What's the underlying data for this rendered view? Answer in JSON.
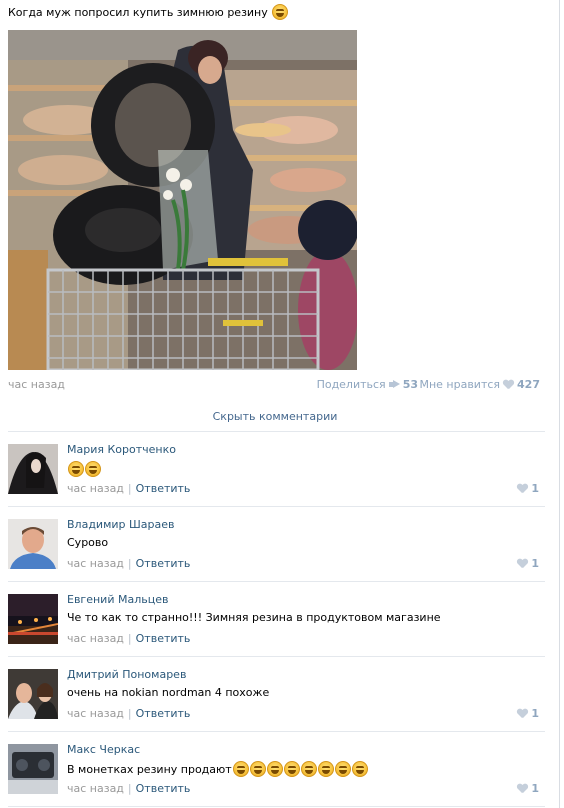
{
  "post": {
    "text": "Когда муж попросил купить зимнюю резину",
    "time": "час назад",
    "share_label": "Поделиться",
    "share_count": "53",
    "like_label": "Мне нравится",
    "like_count": "427",
    "hide_comments_label": "Скрыть комментарии"
  },
  "comments": [
    {
      "author": "Мария Коротченко",
      "text": "",
      "emoji_count": 2,
      "time": "час назад",
      "reply": "Ответить",
      "likes": "1"
    },
    {
      "author": "Владимир Шараев",
      "text": "Сурово",
      "emoji_count": 0,
      "time": "час назад",
      "reply": "Ответить",
      "likes": "1"
    },
    {
      "author": "Евгений Мальцев",
      "text": "Че то как то странно!!! Зимняя резина в продуктовом магазине",
      "emoji_count": 0,
      "time": "час назад",
      "reply": "Ответить",
      "likes": ""
    },
    {
      "author": "Дмитрий Пономарев",
      "text": "очень на nokian nordman 4 похоже",
      "emoji_count": 0,
      "time": "час назад",
      "reply": "Ответить",
      "likes": "1"
    },
    {
      "author": "Макс Черкас",
      "text": "В монетках резину продают",
      "emoji_count": 8,
      "time": "час назад",
      "reply": "Ответить",
      "likes": "1"
    }
  ],
  "colors": {
    "link": "#2b587a",
    "meta": "#999999",
    "like_blue": "#8fa6bf",
    "divider": "#e4e8ed"
  }
}
